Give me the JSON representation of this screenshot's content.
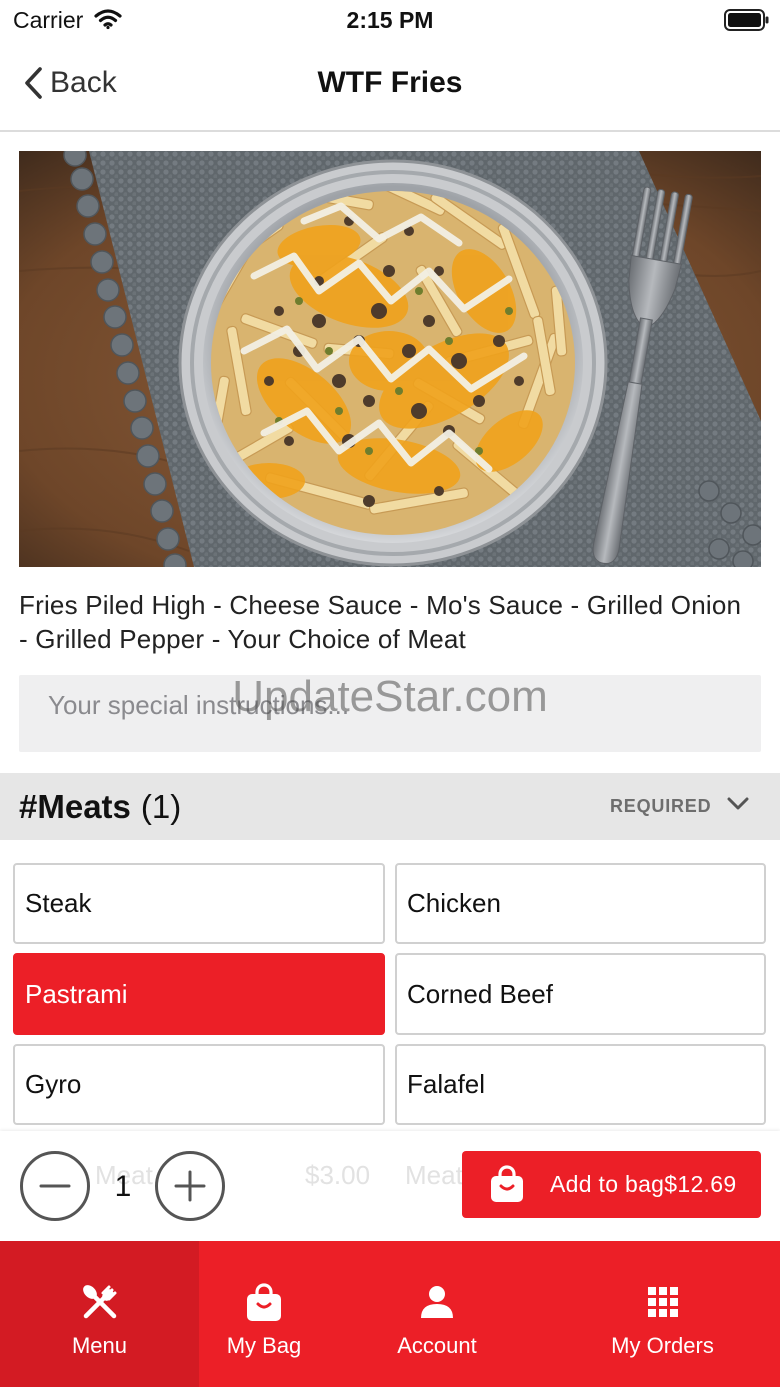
{
  "status_bar": {
    "carrier": "Carrier",
    "time": "2:15 PM",
    "wifi_icon": "wifi-icon",
    "battery_icon": "battery-icon"
  },
  "nav": {
    "back_icon": "chevron-left-icon",
    "back_label": "Back",
    "title": "WTF Fries"
  },
  "product": {
    "description": "Fries Piled High - Cheese Sauce - Mo's Sauce - Grilled Onion - Grilled Pepper - Your Choice of Meat"
  },
  "special_instructions": {
    "placeholder": "Your special instructions...",
    "value": ""
  },
  "watermark": "UpdateStar.com",
  "modifier_group": {
    "name": "#Meats",
    "count": "(1)",
    "requirement": "REQUIRED",
    "toggle_icon": "chevron-down-icon",
    "options": [
      {
        "label": "Steak",
        "selected": false
      },
      {
        "label": "Chicken",
        "selected": false
      },
      {
        "label": "Pastrami",
        "selected": true
      },
      {
        "label": "Corned Beef",
        "selected": false
      },
      {
        "label": "Gyro",
        "selected": false
      },
      {
        "label": "Falafel",
        "selected": false
      }
    ]
  },
  "order_bar": {
    "background_text": [
      "Meat",
      "$3.00",
      "Meat"
    ],
    "decrement_icon": "minus-icon",
    "quantity": "1",
    "increment_icon": "plus-icon",
    "add_button": {
      "icon": "shopping-bag-icon",
      "label": "Add to bag",
      "price": "$12.69"
    }
  },
  "tab_bar": {
    "tabs": [
      {
        "label": "Menu",
        "icon": "fork-knife-icon",
        "active": true
      },
      {
        "label": "My Bag",
        "icon": "shopping-bag-icon",
        "active": false
      },
      {
        "label": "Account",
        "icon": "person-icon",
        "active": false
      },
      {
        "label": "My Orders",
        "icon": "grid-icon",
        "active": false
      }
    ]
  },
  "colors": {
    "accent": "#ec1f27",
    "accent_active": "#d31b23",
    "section_bg": "#e6e6e6",
    "input_bg": "#efeff0"
  }
}
